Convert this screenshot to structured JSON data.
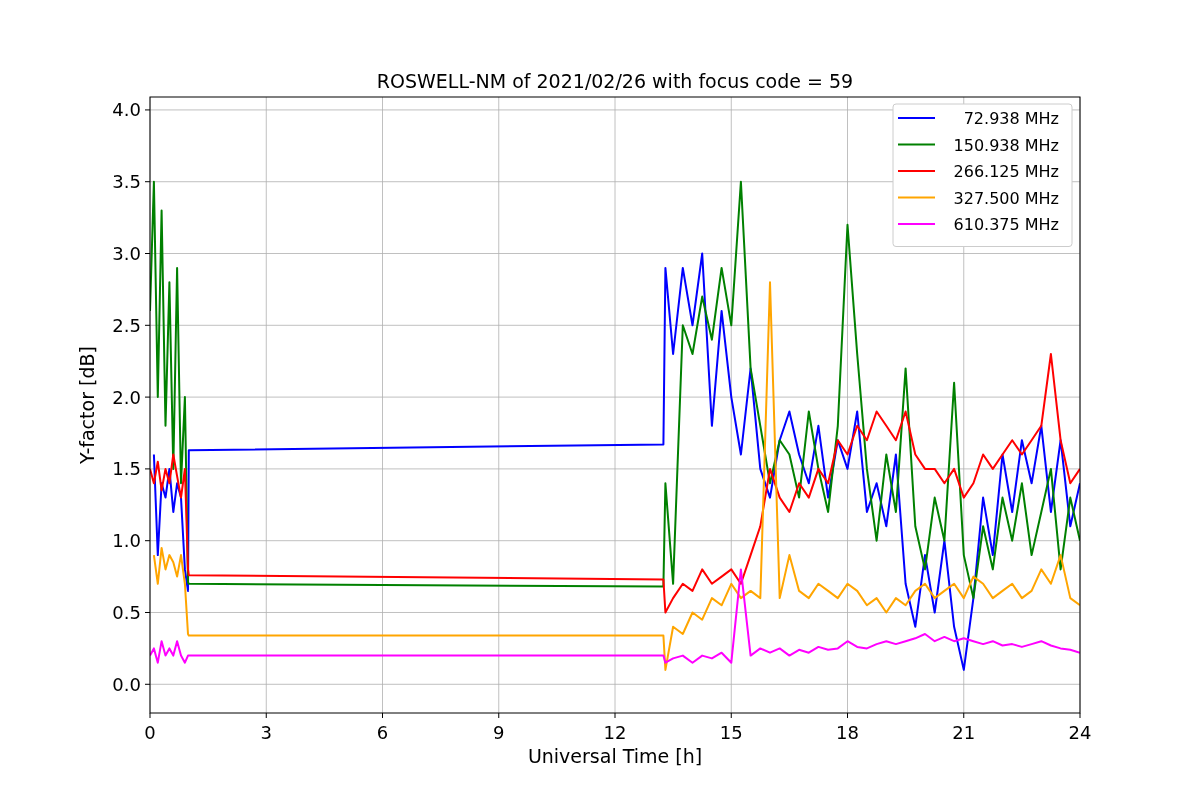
{
  "figure": {
    "chart_data": {
      "type": "line",
      "title": "ROSWELL-NM of 2021/02/26 with focus code = 59",
      "xlabel": "Universal Time [h]",
      "ylabel": "Y-factor [dB]",
      "x": [
        0,
        0.1,
        0.2,
        0.3,
        0.4,
        0.5,
        0.6,
        0.7,
        0.8,
        0.9,
        0.98,
        1.0,
        13.25,
        13.3,
        13.5,
        13.75,
        14,
        14.25,
        14.5,
        14.75,
        15,
        15.25,
        15.5,
        15.75,
        16,
        16.25,
        16.5,
        16.75,
        17,
        17.25,
        17.5,
        17.75,
        18,
        18.25,
        18.5,
        18.75,
        19,
        19.25,
        19.5,
        19.75,
        20,
        20.25,
        20.5,
        20.75,
        21,
        21.25,
        21.5,
        21.75,
        22,
        22.25,
        22.5,
        22.75,
        23,
        23.25,
        23.5,
        23.75,
        24
      ],
      "grid": true,
      "legend": true,
      "xlim": [
        0,
        24
      ],
      "ylim": [
        -0.2,
        4.09
      ],
      "xticks": [
        {
          "value": 0,
          "label": "0"
        },
        {
          "value": 3,
          "label": "3"
        },
        {
          "value": 6,
          "label": "6"
        },
        {
          "value": 9,
          "label": "9"
        },
        {
          "value": 12,
          "label": "12"
        },
        {
          "value": 15,
          "label": "15"
        },
        {
          "value": 18,
          "label": "18"
        },
        {
          "value": 21,
          "label": "21"
        },
        {
          "value": 24,
          "label": "24"
        }
      ],
      "yticks": [
        {
          "value": 0,
          "label": "0.0"
        },
        {
          "value": 0.5,
          "label": "0.5"
        },
        {
          "value": 1,
          "label": "1.0"
        },
        {
          "value": 1.5,
          "label": "1.5"
        },
        {
          "value": 2,
          "label": "2.0"
        },
        {
          "value": 2.5,
          "label": "2.5"
        },
        {
          "value": 3,
          "label": "3.0"
        },
        {
          "value": 3.5,
          "label": "3.5"
        },
        {
          "value": 4,
          "label": "4.0"
        }
      ],
      "series": [
        {
          "name": "72.938 MHz",
          "color": "#0000ff",
          "values": [
            null,
            1.6,
            0.9,
            1.4,
            1.3,
            1.5,
            1.2,
            1.4,
            1.3,
            0.8,
            0.65,
            1.63,
            1.67,
            2.9,
            2.3,
            2.9,
            2.5,
            3.0,
            1.8,
            2.6,
            2.0,
            1.6,
            2.2,
            1.5,
            1.3,
            1.7,
            1.9,
            1.6,
            1.4,
            1.8,
            1.3,
            1.7,
            1.5,
            1.9,
            1.2,
            1.4,
            1.1,
            1.6,
            0.7,
            0.4,
            0.9,
            0.5,
            1.0,
            0.4,
            0.1,
            0.6,
            1.3,
            0.9,
            1.6,
            1.2,
            1.7,
            1.4,
            1.8,
            1.2,
            1.7,
            1.1,
            1.4
          ]
        },
        {
          "name": "150.938 MHz",
          "color": "#008000",
          "values": [
            2.6,
            3.5,
            2.0,
            3.3,
            1.8,
            2.8,
            1.5,
            2.9,
            1.4,
            2.0,
            0.71,
            0.7,
            0.68,
            1.4,
            0.7,
            2.5,
            2.3,
            2.7,
            2.4,
            2.9,
            2.5,
            3.5,
            2.2,
            1.8,
            1.4,
            1.7,
            1.6,
            1.3,
            1.9,
            1.5,
            1.2,
            1.8,
            3.2,
            2.3,
            1.5,
            1.0,
            1.6,
            1.2,
            2.2,
            1.1,
            0.8,
            1.3,
            1.0,
            2.1,
            0.9,
            0.6,
            1.1,
            0.8,
            1.3,
            1.0,
            1.4,
            0.9,
            1.2,
            1.5,
            0.8,
            1.3,
            1.0
          ]
        },
        {
          "name": "266.125 MHz",
          "color": "#ff0000",
          "values": [
            1.5,
            1.4,
            1.55,
            1.35,
            1.5,
            1.4,
            1.6,
            1.45,
            1.3,
            1.5,
            0.8,
            0.76,
            0.73,
            0.5,
            0.6,
            0.7,
            0.65,
            0.8,
            0.7,
            0.75,
            0.8,
            0.7,
            0.9,
            1.1,
            1.5,
            1.3,
            1.2,
            1.4,
            1.3,
            1.5,
            1.4,
            1.7,
            1.6,
            1.8,
            1.7,
            1.9,
            1.8,
            1.7,
            1.9,
            1.6,
            1.5,
            1.5,
            1.4,
            1.5,
            1.3,
            1.4,
            1.6,
            1.5,
            1.6,
            1.7,
            1.6,
            1.7,
            1.8,
            2.3,
            1.7,
            1.4,
            1.5
          ]
        },
        {
          "name": "327.500 MHz",
          "color": "#ffa500",
          "values": [
            null,
            0.9,
            0.7,
            0.95,
            0.8,
            0.9,
            0.85,
            0.75,
            0.9,
            0.7,
            0.35,
            0.34,
            0.34,
            0.1,
            0.4,
            0.35,
            0.5,
            0.45,
            0.6,
            0.55,
            0.7,
            0.6,
            0.65,
            0.6,
            2.8,
            0.6,
            0.9,
            0.65,
            0.6,
            0.7,
            0.65,
            0.6,
            0.7,
            0.65,
            0.55,
            0.6,
            0.5,
            0.6,
            0.55,
            0.65,
            0.7,
            0.6,
            0.65,
            0.7,
            0.6,
            0.75,
            0.7,
            0.6,
            0.65,
            0.7,
            0.6,
            0.65,
            0.8,
            0.7,
            0.9,
            0.6,
            0.55
          ]
        },
        {
          "name": "610.375 MHz",
          "color": "#ff00ff",
          "values": [
            0.2,
            0.25,
            0.15,
            0.3,
            0.2,
            0.25,
            0.2,
            0.3,
            0.2,
            0.15,
            0.2,
            0.2,
            0.2,
            0.15,
            0.18,
            0.2,
            0.15,
            0.2,
            0.18,
            0.22,
            0.15,
            0.8,
            0.2,
            0.25,
            0.22,
            0.25,
            0.2,
            0.24,
            0.22,
            0.26,
            0.24,
            0.25,
            0.3,
            0.26,
            0.25,
            0.28,
            0.3,
            0.28,
            0.3,
            0.32,
            0.35,
            0.3,
            0.33,
            0.3,
            0.32,
            0.3,
            0.28,
            0.3,
            0.27,
            0.28,
            0.26,
            0.28,
            0.3,
            0.27,
            0.25,
            0.24,
            0.22
          ]
        }
      ]
    }
  }
}
